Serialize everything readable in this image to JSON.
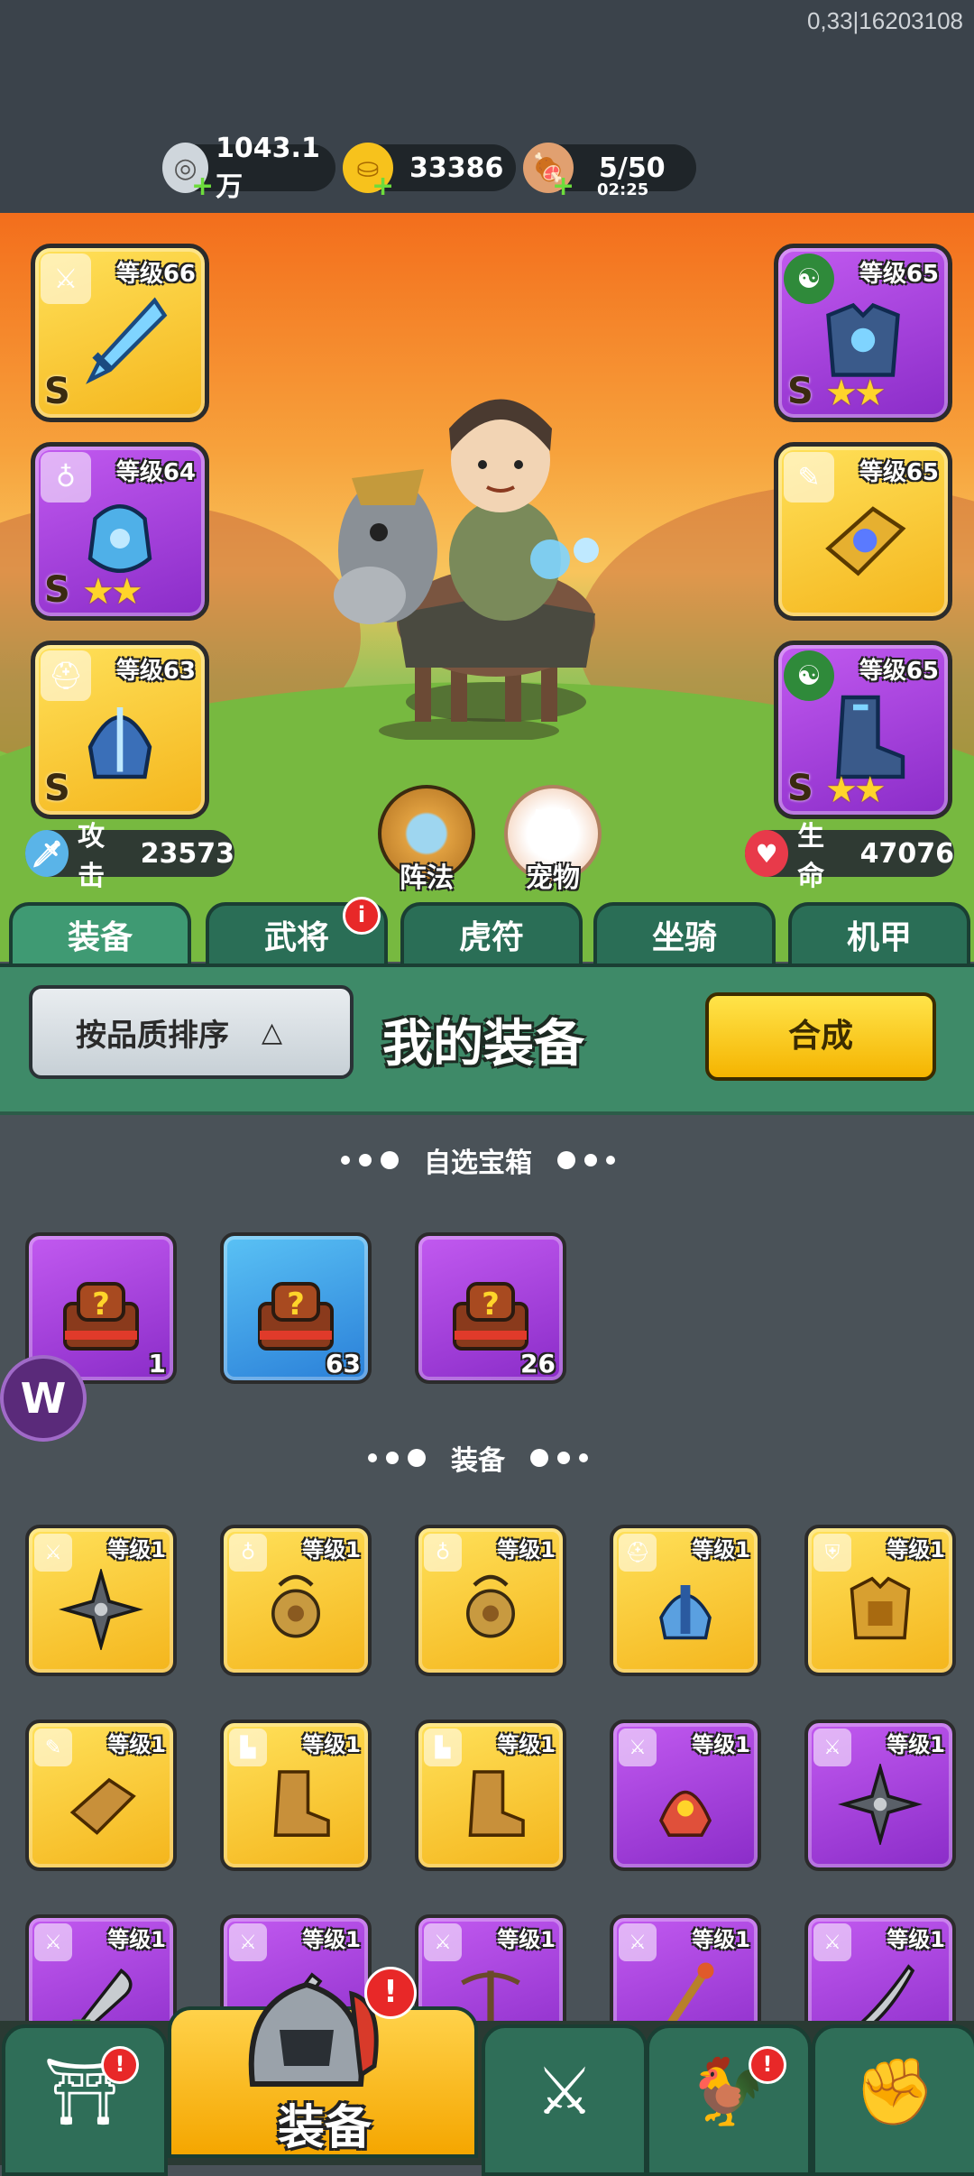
{
  "debug_text": "0,33|16203108",
  "resources": [
    {
      "name": "silver",
      "value": "1043.1万",
      "icon": "silver-coin-icon"
    },
    {
      "name": "gold",
      "value": "33386",
      "icon": "gold-ingot-icon"
    },
    {
      "name": "stamina",
      "value": "5/50",
      "timer": "02:25",
      "icon": "meat-icon"
    }
  ],
  "hero_slots": {
    "left": [
      {
        "level": "等级66",
        "rank": "S",
        "stars": "",
        "color": "gold",
        "type_icon": "sword-type-icon",
        "item_icon": "ice-sword-icon"
      },
      {
        "level": "等级64",
        "rank": "S",
        "stars": "★★",
        "color": "purple",
        "type_icon": "medal-type-icon",
        "item_icon": "ice-gauntlet-icon"
      },
      {
        "level": "等级63",
        "rank": "S",
        "stars": "",
        "color": "gold",
        "type_icon": "helmet-type-icon",
        "item_icon": "ice-helmet-icon"
      }
    ],
    "right": [
      {
        "level": "等级65",
        "rank": "S",
        "stars": "★★",
        "color": "purple",
        "type_icon": "yinyang-type-icon",
        "item_icon": "ice-armor-icon"
      },
      {
        "level": "等级65",
        "rank": "",
        "stars": "",
        "color": "gold",
        "type_icon": "scroll-type-icon",
        "item_icon": "jewel-bracer-icon"
      },
      {
        "level": "等级65",
        "rank": "S",
        "stars": "★★",
        "color": "purple",
        "type_icon": "yinyang-type-icon",
        "item_icon": "ice-boot-icon"
      }
    ]
  },
  "stats": {
    "attack_label": "攻击",
    "attack_value": "23573",
    "hp_label": "生命",
    "hp_value": "47076"
  },
  "round_buttons": [
    {
      "label": "阵法",
      "icon": "formation-icon"
    },
    {
      "label": "宠物",
      "icon": "pet-cat-icon"
    }
  ],
  "tabs": [
    {
      "label": "装备",
      "active": true
    },
    {
      "label": "武将",
      "badge": "i"
    },
    {
      "label": "虎符"
    },
    {
      "label": "坐骑"
    },
    {
      "label": "机甲"
    }
  ],
  "toolbar": {
    "sort_label": "按品质排序",
    "title": "我的装备",
    "merge_label": "合成"
  },
  "sections": {
    "chest_title": "自选宝箱",
    "equip_title": "装备"
  },
  "chests": [
    {
      "count": "1",
      "color": "purple"
    },
    {
      "count": "63",
      "color": "blue"
    },
    {
      "count": "26",
      "color": "purple"
    }
  ],
  "equipment": [
    {
      "level": "等级1",
      "color": "gold",
      "item_icon": "shuriken-icon"
    },
    {
      "level": "等级1",
      "color": "gold",
      "item_icon": "amulet-icon"
    },
    {
      "level": "等级1",
      "color": "gold",
      "item_icon": "amulet-icon"
    },
    {
      "level": "等级1",
      "color": "gold",
      "item_icon": "blue-helmet-icon"
    },
    {
      "level": "等级1",
      "color": "gold",
      "item_icon": "gold-armor-icon"
    },
    {
      "level": "等级1",
      "color": "gold",
      "item_icon": "bracer-icon"
    },
    {
      "level": "等级1",
      "color": "gold",
      "item_icon": "boots-icon"
    },
    {
      "level": "等级1",
      "color": "gold",
      "item_icon": "boots-icon"
    },
    {
      "level": "等级1",
      "color": "purple",
      "item_icon": "phoenix-helmet-icon"
    },
    {
      "level": "等级1",
      "color": "purple",
      "item_icon": "shuriken-icon"
    },
    {
      "level": "等级1",
      "color": "purple",
      "item_icon": "broadsword-icon"
    },
    {
      "level": "等级1",
      "color": "purple",
      "item_icon": "dagger-icon"
    },
    {
      "level": "等级1",
      "color": "purple",
      "item_icon": "crossbow-icon"
    },
    {
      "level": "等级1",
      "color": "purple",
      "item_icon": "staff-icon"
    },
    {
      "level": "等级1",
      "color": "purple",
      "item_icon": "sabre-icon"
    }
  ],
  "bottom_nav": [
    {
      "label": "",
      "icon": "gate-shop-icon",
      "badge": "!"
    },
    {
      "label": "装备",
      "icon": "knight-helmet-icon",
      "badge": "!",
      "active": true
    },
    {
      "label": "",
      "icon": "crossed-swords-shield-icon"
    },
    {
      "label": "",
      "icon": "rooster-stars-icon",
      "badge": "!"
    },
    {
      "label": "",
      "icon": "fist-upgrade-icon"
    }
  ],
  "colors": {
    "tab_green": "#3f9a73",
    "panel_green": "#3e8a68",
    "gold_slot": "#f4b51c",
    "purple_slot": "#8a2cc8",
    "blue_slot": "#2a7fd8",
    "badge_red": "#e82828"
  }
}
